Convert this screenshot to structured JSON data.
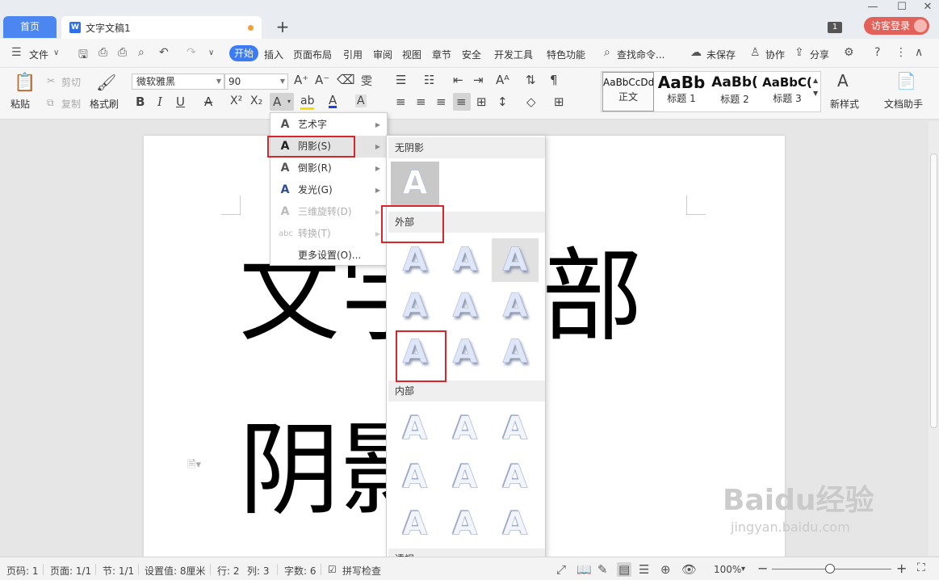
{
  "tabs": {
    "home": "首页",
    "doc_title": "文字文稿1",
    "doc_icon": "W",
    "add": "+"
  },
  "topright": {
    "badge": "1",
    "login": "访客登录"
  },
  "menubar": {
    "file": "文件",
    "start": "开始",
    "items": [
      "插入",
      "页面布局",
      "引用",
      "审阅",
      "视图",
      "章节",
      "安全",
      "开发工具",
      "特色功能"
    ],
    "search": "查找命令...",
    "unsaved": "未保存",
    "collab": "协作",
    "share": "分享"
  },
  "ribbon": {
    "paste": "粘贴",
    "cut": "剪切",
    "copy": "复制",
    "format_painter": "格式刷",
    "font_name": "微软雅黑",
    "font_size": "90",
    "styles": [
      {
        "sample": "AaBbCcDd",
        "label": "正文"
      },
      {
        "sample": "AaBb",
        "label": "标题 1"
      },
      {
        "sample": "AaBb(",
        "label": "标题 2"
      },
      {
        "sample": "AaBbC(",
        "label": "标题 3"
      }
    ],
    "new_style": "新样式",
    "doc_helper": "文档助手"
  },
  "document": {
    "line1": "文字、部",
    "line2": "阴影"
  },
  "text_effects_menu": {
    "items": [
      {
        "label": "艺术字",
        "disabled": false
      },
      {
        "label": "阴影(S)",
        "disabled": false
      },
      {
        "label": "倒影(R)",
        "disabled": false
      },
      {
        "label": "发光(G)",
        "disabled": false
      },
      {
        "label": "三维旋转(D)",
        "disabled": true
      },
      {
        "label": "转换(T)",
        "disabled": true
      },
      {
        "label": "更多设置(O)...",
        "disabled": false
      }
    ]
  },
  "shadow_gallery": {
    "no_shadow": "无阴影",
    "outer": "外部",
    "inner": "内部",
    "perspective": "透视",
    "glyph": "A"
  },
  "statusbar": {
    "page_code": "页码: 1",
    "pages": "页面: 1/1",
    "section": "节: 1/1",
    "setting": "设置值: 8厘米",
    "row": "行: 2",
    "col": "列: 3",
    "words": "字数: 6",
    "spell": "拼写检查",
    "zoom": "100%"
  },
  "watermark": {
    "brand": "Baidu经验",
    "url": "jingyan.baidu.com"
  },
  "colors": {
    "accent": "#3b7cf6",
    "home_tab": "#4c86f0",
    "login": "#e2625a",
    "highlight_box": "#d9262c"
  }
}
